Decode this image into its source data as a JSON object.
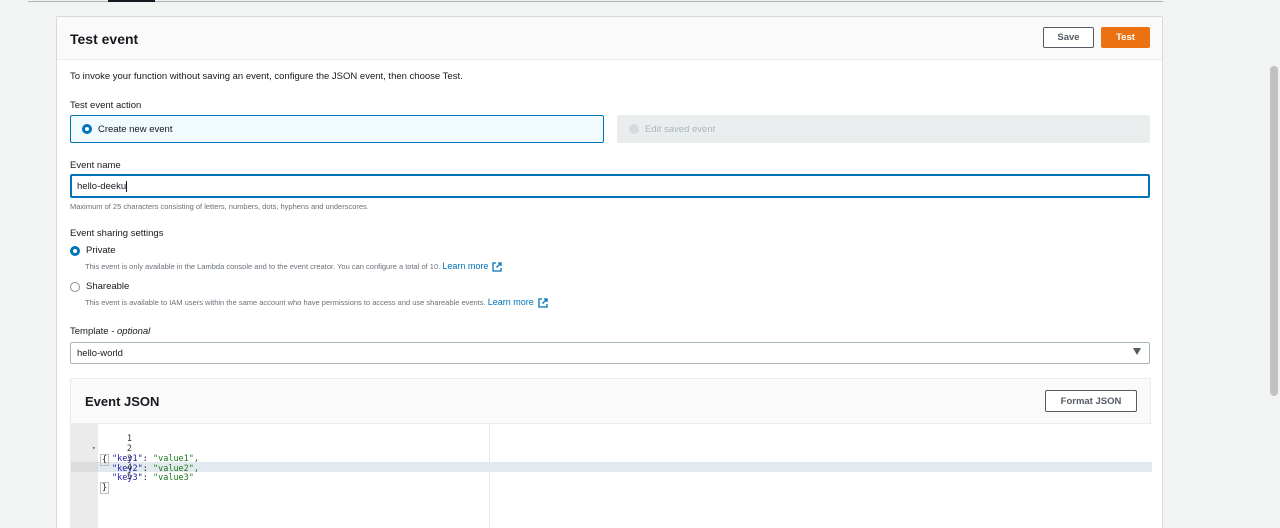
{
  "panel": {
    "title": "Test event",
    "save_label": "Save",
    "test_label": "Test"
  },
  "intro": "To invoke your function without saving an event, configure the JSON event, then choose Test.",
  "event_action": {
    "label": "Test event action",
    "options": [
      {
        "label": "Create new event",
        "selected": true,
        "disabled": false
      },
      {
        "label": "Edit saved event",
        "selected": false,
        "disabled": true
      }
    ]
  },
  "event_name": {
    "label": "Event name",
    "value": "hello-deeku",
    "hint": "Maximum of 25 characters consisting of letters, numbers, dots, hyphens and underscores."
  },
  "sharing": {
    "label": "Event sharing settings",
    "options": [
      {
        "label": "Private",
        "selected": true,
        "description": "This event is only available in the Lambda console and to the event creator. You can configure a total of 10.",
        "link": "Learn more"
      },
      {
        "label": "Shareable",
        "selected": false,
        "description": "This event is available to IAM users within the same account who have permissions to access and use shareable events.",
        "link": "Learn more"
      }
    ]
  },
  "template": {
    "label": "Template",
    "label_suffix": "optional",
    "value": "hello-world"
  },
  "event_json": {
    "title": "Event JSON",
    "format_label": "Format JSON",
    "lines": [
      {
        "n": "1",
        "text": "{"
      },
      {
        "n": "2",
        "key": "\"key1\"",
        "value": "\"value1\","
      },
      {
        "n": "3",
        "key": "\"key2\"",
        "value": "\"value2\","
      },
      {
        "n": "4",
        "key": "\"key3\"",
        "value": "\"value3\""
      },
      {
        "n": "5",
        "text": "}"
      }
    ]
  },
  "colors": {
    "accent": "#0073bb",
    "primary_button": "#ec7211"
  }
}
